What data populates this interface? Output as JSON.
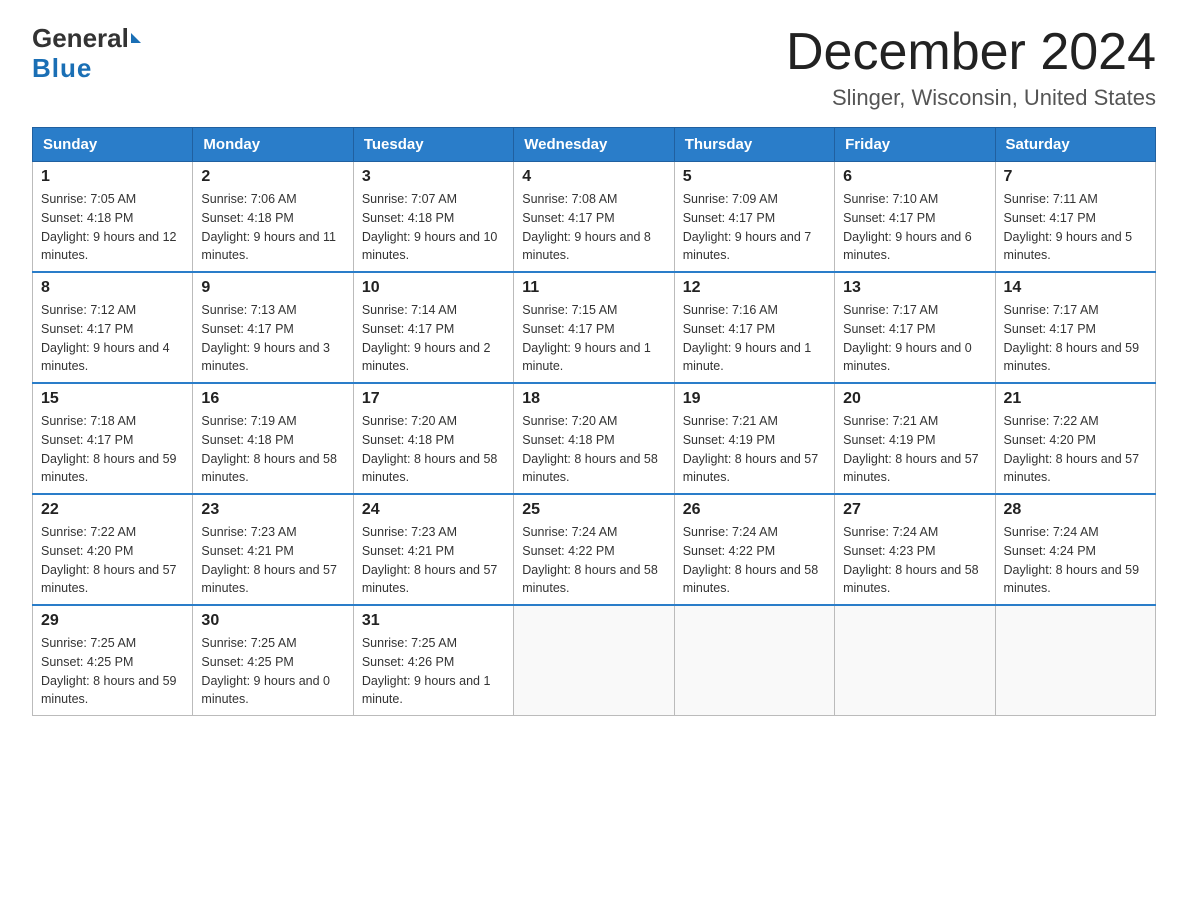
{
  "logo": {
    "general": "General",
    "blue": "Blue"
  },
  "title": "December 2024",
  "subtitle": "Slinger, Wisconsin, United States",
  "headers": [
    "Sunday",
    "Monday",
    "Tuesday",
    "Wednesday",
    "Thursday",
    "Friday",
    "Saturday"
  ],
  "weeks": [
    [
      {
        "day": "1",
        "sunrise": "7:05 AM",
        "sunset": "4:18 PM",
        "daylight": "9 hours and 12 minutes."
      },
      {
        "day": "2",
        "sunrise": "7:06 AM",
        "sunset": "4:18 PM",
        "daylight": "9 hours and 11 minutes."
      },
      {
        "day": "3",
        "sunrise": "7:07 AM",
        "sunset": "4:18 PM",
        "daylight": "9 hours and 10 minutes."
      },
      {
        "day": "4",
        "sunrise": "7:08 AM",
        "sunset": "4:17 PM",
        "daylight": "9 hours and 8 minutes."
      },
      {
        "day": "5",
        "sunrise": "7:09 AM",
        "sunset": "4:17 PM",
        "daylight": "9 hours and 7 minutes."
      },
      {
        "day": "6",
        "sunrise": "7:10 AM",
        "sunset": "4:17 PM",
        "daylight": "9 hours and 6 minutes."
      },
      {
        "day": "7",
        "sunrise": "7:11 AM",
        "sunset": "4:17 PM",
        "daylight": "9 hours and 5 minutes."
      }
    ],
    [
      {
        "day": "8",
        "sunrise": "7:12 AM",
        "sunset": "4:17 PM",
        "daylight": "9 hours and 4 minutes."
      },
      {
        "day": "9",
        "sunrise": "7:13 AM",
        "sunset": "4:17 PM",
        "daylight": "9 hours and 3 minutes."
      },
      {
        "day": "10",
        "sunrise": "7:14 AM",
        "sunset": "4:17 PM",
        "daylight": "9 hours and 2 minutes."
      },
      {
        "day": "11",
        "sunrise": "7:15 AM",
        "sunset": "4:17 PM",
        "daylight": "9 hours and 1 minute."
      },
      {
        "day": "12",
        "sunrise": "7:16 AM",
        "sunset": "4:17 PM",
        "daylight": "9 hours and 1 minute."
      },
      {
        "day": "13",
        "sunrise": "7:17 AM",
        "sunset": "4:17 PM",
        "daylight": "9 hours and 0 minutes."
      },
      {
        "day": "14",
        "sunrise": "7:17 AM",
        "sunset": "4:17 PM",
        "daylight": "8 hours and 59 minutes."
      }
    ],
    [
      {
        "day": "15",
        "sunrise": "7:18 AM",
        "sunset": "4:17 PM",
        "daylight": "8 hours and 59 minutes."
      },
      {
        "day": "16",
        "sunrise": "7:19 AM",
        "sunset": "4:18 PM",
        "daylight": "8 hours and 58 minutes."
      },
      {
        "day": "17",
        "sunrise": "7:20 AM",
        "sunset": "4:18 PM",
        "daylight": "8 hours and 58 minutes."
      },
      {
        "day": "18",
        "sunrise": "7:20 AM",
        "sunset": "4:18 PM",
        "daylight": "8 hours and 58 minutes."
      },
      {
        "day": "19",
        "sunrise": "7:21 AM",
        "sunset": "4:19 PM",
        "daylight": "8 hours and 57 minutes."
      },
      {
        "day": "20",
        "sunrise": "7:21 AM",
        "sunset": "4:19 PM",
        "daylight": "8 hours and 57 minutes."
      },
      {
        "day": "21",
        "sunrise": "7:22 AM",
        "sunset": "4:20 PM",
        "daylight": "8 hours and 57 minutes."
      }
    ],
    [
      {
        "day": "22",
        "sunrise": "7:22 AM",
        "sunset": "4:20 PM",
        "daylight": "8 hours and 57 minutes."
      },
      {
        "day": "23",
        "sunrise": "7:23 AM",
        "sunset": "4:21 PM",
        "daylight": "8 hours and 57 minutes."
      },
      {
        "day": "24",
        "sunrise": "7:23 AM",
        "sunset": "4:21 PM",
        "daylight": "8 hours and 57 minutes."
      },
      {
        "day": "25",
        "sunrise": "7:24 AM",
        "sunset": "4:22 PM",
        "daylight": "8 hours and 58 minutes."
      },
      {
        "day": "26",
        "sunrise": "7:24 AM",
        "sunset": "4:22 PM",
        "daylight": "8 hours and 58 minutes."
      },
      {
        "day": "27",
        "sunrise": "7:24 AM",
        "sunset": "4:23 PM",
        "daylight": "8 hours and 58 minutes."
      },
      {
        "day": "28",
        "sunrise": "7:24 AM",
        "sunset": "4:24 PM",
        "daylight": "8 hours and 59 minutes."
      }
    ],
    [
      {
        "day": "29",
        "sunrise": "7:25 AM",
        "sunset": "4:25 PM",
        "daylight": "8 hours and 59 minutes."
      },
      {
        "day": "30",
        "sunrise": "7:25 AM",
        "sunset": "4:25 PM",
        "daylight": "9 hours and 0 minutes."
      },
      {
        "day": "31",
        "sunrise": "7:25 AM",
        "sunset": "4:26 PM",
        "daylight": "9 hours and 1 minute."
      },
      null,
      null,
      null,
      null
    ]
  ]
}
